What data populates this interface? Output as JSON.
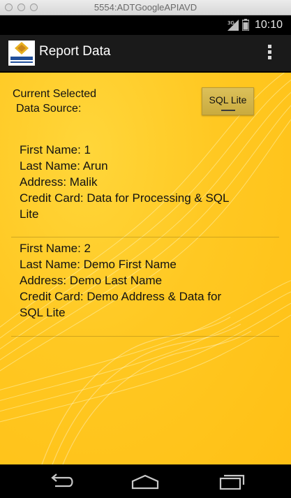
{
  "window": {
    "title": "5554:ADTGoogleAPIAVD"
  },
  "status_bar": {
    "network": "3G",
    "time": "10:10"
  },
  "action_bar": {
    "title": "Report Data",
    "logo_icon": "san-jose-state-university-logo",
    "overflow_icon": "overflow-menu-icon"
  },
  "data_source": {
    "label_line1": "Current Selected",
    "label_line2": "Data Source:",
    "button_label": "SQL Lite"
  },
  "records": [
    {
      "first_name": "First Name: 1",
      "last_name": "Last Name: Arun",
      "address": "Address: Malik",
      "credit_card_line1": "Credit Card: Data for Processing & SQL",
      "credit_card_line2": "Lite"
    },
    {
      "first_name": "First Name: 2",
      "last_name": "Last Name: Demo First Name",
      "address": "Address: Demo Last Name",
      "credit_card_line1": "Credit Card: Demo Address & Data for",
      "credit_card_line2": "SQL Lite"
    }
  ],
  "nav_bar": {
    "back_icon": "back-icon",
    "home_icon": "home-icon",
    "recent_icon": "recent-apps-icon"
  },
  "colors": {
    "background_accent": "#ffc822",
    "action_bar": "#1a1a1a",
    "status_bar": "#000000"
  }
}
